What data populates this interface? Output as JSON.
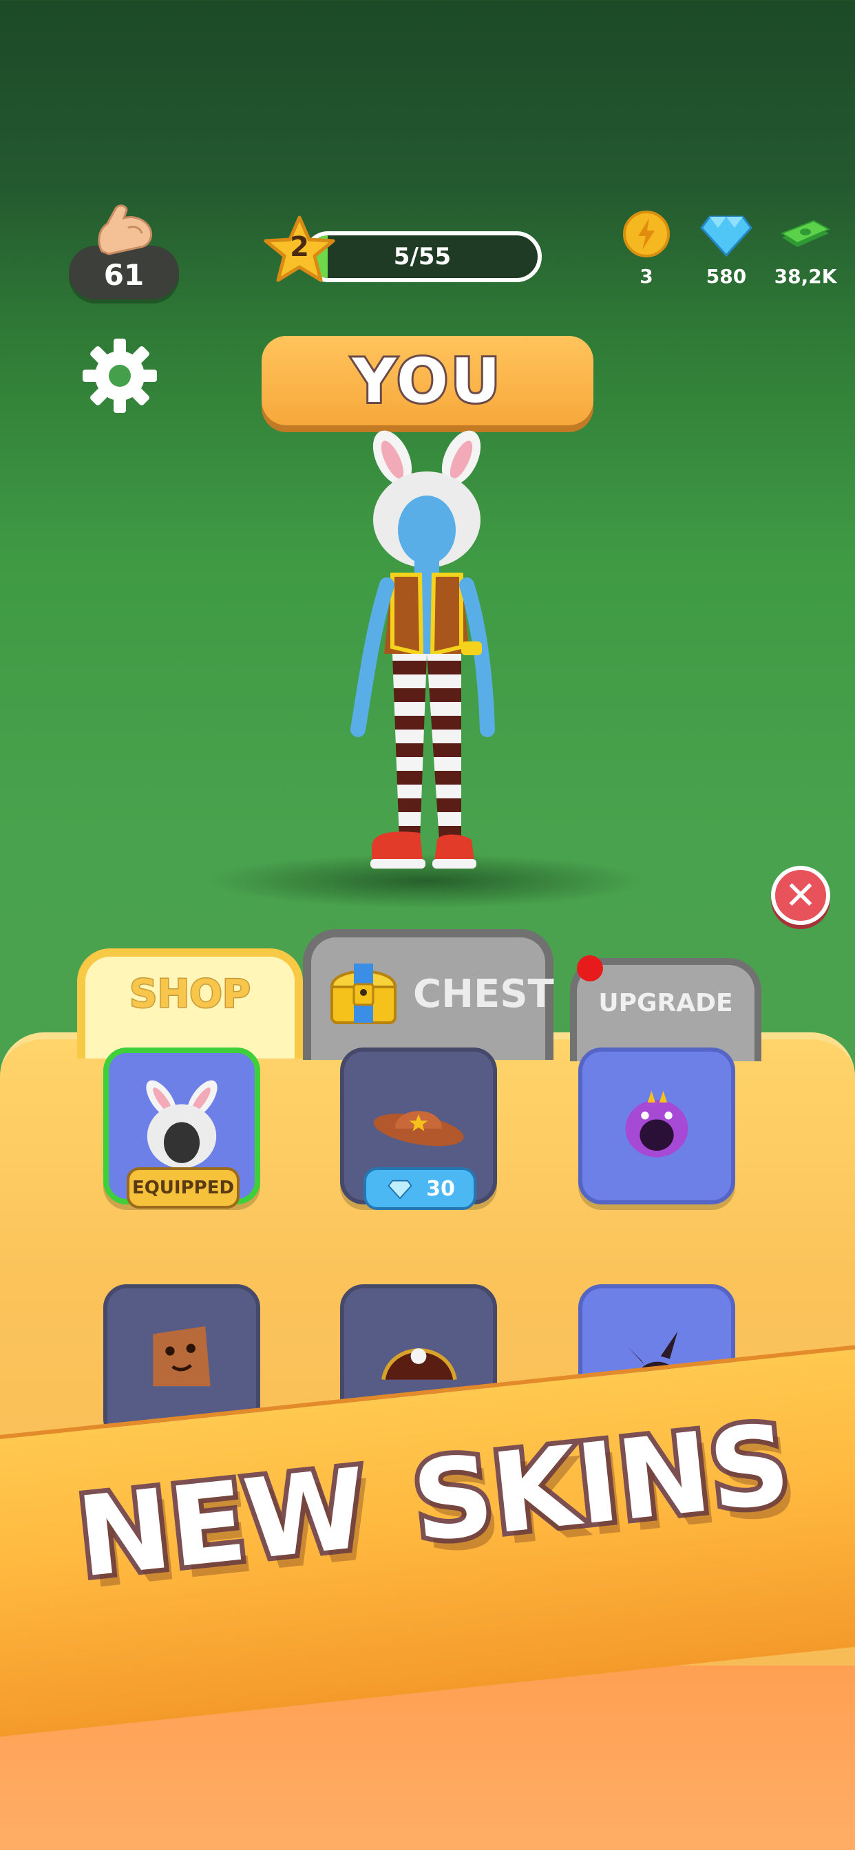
{
  "hud": {
    "strength_value": "61",
    "level_number": "2",
    "level_progress_text": "5/55",
    "level_progress_fraction": 0.09,
    "energy_count": "3",
    "gems_count": "580",
    "cash_count": "38,2K"
  },
  "banner": {
    "title": "YOU"
  },
  "tabs": {
    "shop_label": "SHOP",
    "chest_label": "CHEST",
    "upgrade_label": "UPGRADE",
    "upgrade_has_notification": true
  },
  "shop": {
    "items": [
      {
        "icon": "bunny-hood-icon",
        "state": "equipped",
        "badge": "EQUIPPED"
      },
      {
        "icon": "cowboy-hat-icon",
        "state": "locked",
        "price": "30",
        "currency": "gem"
      },
      {
        "icon": "purple-monster-hood-icon",
        "state": "owned"
      },
      {
        "icon": "paper-bag-mask-icon",
        "state": "locked"
      },
      {
        "icon": "pirate-hat-icon",
        "state": "locked"
      },
      {
        "icon": "dark-horned-hood-icon",
        "state": "owned"
      }
    ]
  },
  "promo": {
    "word1": "NEW",
    "word2": "SKINS"
  },
  "colors": {
    "accent_orange": "#f7a83b",
    "panel_yellow": "#fbc35a",
    "equipped_green": "#3ed03a",
    "gem_blue": "#4bb8f3",
    "close_red": "#e8525a"
  }
}
